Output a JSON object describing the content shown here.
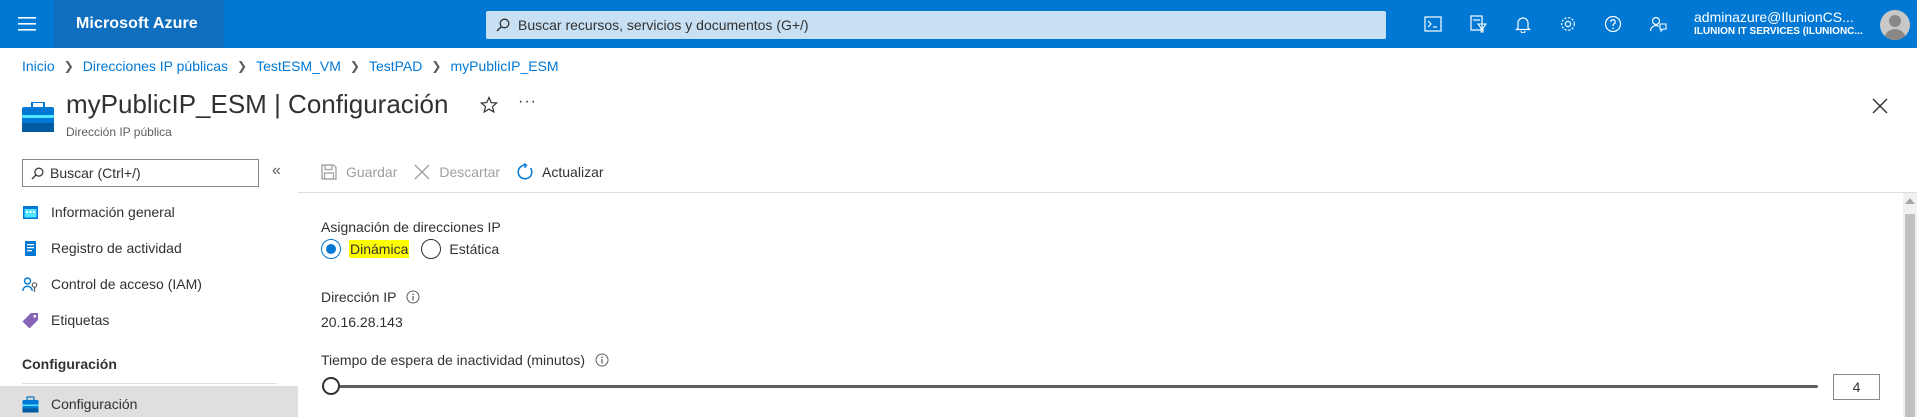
{
  "topbar": {
    "brand": "Microsoft Azure",
    "search_placeholder": "Buscar recursos, servicios y documentos (G+/)",
    "icons": [
      "cloud-shell-icon",
      "directory-filter-icon",
      "notifications-icon",
      "settings-icon",
      "help-icon",
      "feedback-icon"
    ],
    "account": {
      "name": "adminazure@IlunionCS...",
      "directory": "ILUNION IT SERVICES (ILUNIONC..."
    }
  },
  "breadcrumb": [
    "Inicio",
    "Direcciones IP públicas",
    "TestESM_VM",
    "TestPAD",
    "myPublicIP_ESM"
  ],
  "header": {
    "title": "myPublicIP_ESM | Configuración",
    "subtitle": "Dirección IP pública",
    "more": "···"
  },
  "nav": {
    "search_placeholder": "Buscar (Ctrl+/)",
    "collapse": "«",
    "items": [
      {
        "label": "Información general",
        "icon": "overview-icon"
      },
      {
        "label": "Registro de actividad",
        "icon": "activity-log-icon"
      },
      {
        "label": "Control de acceso (IAM)",
        "icon": "access-control-icon"
      },
      {
        "label": "Etiquetas",
        "icon": "tag-icon"
      }
    ],
    "section": "Configuración",
    "section_items": [
      {
        "label": "Configuración",
        "icon": "configuration-icon",
        "selected": true
      }
    ]
  },
  "commands": {
    "save": "Guardar",
    "discard": "Descartar",
    "refresh": "Actualizar"
  },
  "content": {
    "assignment_label": "Asignación de direcciones IP",
    "assignment_options": [
      "Dinámica",
      "Estática"
    ],
    "assignment_selected": "Dinámica",
    "ip_label": "Dirección IP",
    "ip_value": "20.16.28.143",
    "idle_label": "Tiempo de espera de inactividad (minutos)",
    "idle_value": "4",
    "idle_fraction": 0
  },
  "colors": {
    "accent": "#0078d4",
    "highlight": "#ffff00"
  }
}
